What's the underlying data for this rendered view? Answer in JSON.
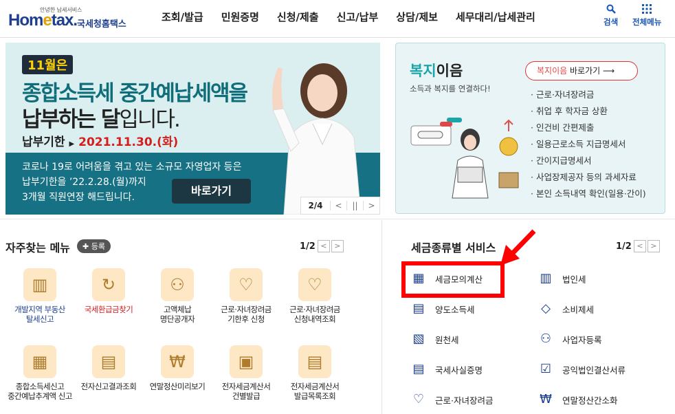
{
  "header": {
    "logo_small": "안녕한 납세서비스",
    "logo_brand_a": "Hom",
    "logo_brand_e": "e",
    "logo_brand_b": "tax.",
    "logo_kr": "국세청홈택스",
    "nav": [
      "조회/발급",
      "민원증명",
      "신청/제출",
      "신고/납부",
      "상담/제보",
      "세무대리/납세관리"
    ],
    "search_label": "검색",
    "menu_label": "전체메뉴"
  },
  "banner": {
    "month": "11월은",
    "headline1": "종합소득세 중간예납세액을",
    "headline2_bold": "납부하는 달",
    "headline2_rest": "입니다.",
    "due_label": "납부기한",
    "due_date": "2021.11.30.(화)",
    "body_line1": "코로나 19로 어려움을 겪고 있는 소규모 자영업자 등은",
    "body_line2": "납부기한을 ’22.2.28.(월)까지",
    "body_line3": "3개월 직원연장 해드립니다.",
    "go_label": "바로가기",
    "pager_count": "2/4",
    "pager_prev": "<",
    "pager_pause": "||",
    "pager_next": ">"
  },
  "welfare": {
    "title_accent": "복지",
    "title_rest": "이음",
    "subtitle": "소득과 복지를 연결하다!",
    "go_accent": "복지이음",
    "go_rest": "바로가기 ⟶",
    "items": [
      "근로·자녀장려금",
      "취업 후 학자금 상환",
      "인건비 간편제출",
      "일용근로소득 지급명세서",
      "간이지급명세서",
      "사업장제공자 등의 과세자료",
      "본인 소득내역 확인(일용·간이)"
    ]
  },
  "favorites": {
    "title": "자주찾는 메뉴",
    "register": "✚ 등록",
    "page": "1/2",
    "items": [
      {
        "l1": "개발지역 부동산",
        "l2": "탈세신고",
        "icon": "building-icon",
        "color": "#1e3f8f"
      },
      {
        "l1": "국세환급금찾기",
        "l2": "",
        "icon": "refund-icon",
        "color": "#d41d1d"
      },
      {
        "l1": "고액체납",
        "l2": "명단공개자",
        "icon": "people-icon",
        "color": "#222"
      },
      {
        "l1": "근로·자녀장려금",
        "l2": "기한후 신청",
        "icon": "heart-icon",
        "color": "#222"
      },
      {
        "l1": "근로·자녀장려금",
        "l2": "신청내역조회",
        "icon": "heart-search-icon",
        "color": "#222"
      },
      {
        "l1": "종합소득세신고",
        "l2": "중간예납추계액 신고",
        "icon": "calendar-icon",
        "color": "#222"
      },
      {
        "l1": "전자신고결과조회",
        "l2": "",
        "icon": "document-search-icon",
        "color": "#222"
      },
      {
        "l1": "연말정산미리보기",
        "l2": "",
        "icon": "money-bag-icon",
        "color": "#222"
      },
      {
        "l1": "전자세금계산서",
        "l2": "건별발급",
        "icon": "calculator-icon",
        "color": "#222"
      },
      {
        "l1": "전자세금계산서",
        "l2": "발급목록조회",
        "icon": "list-search-icon",
        "color": "#222"
      }
    ]
  },
  "taxservice": {
    "title": "세금종류별 서비스",
    "page": "1/2",
    "left": [
      {
        "label": "세금모의계산",
        "icon": "calculator-icon"
      },
      {
        "label": "양도소득세",
        "icon": "transfer-doc-icon"
      },
      {
        "label": "원천세",
        "icon": "receipt-icon"
      },
      {
        "label": "국세사실증명",
        "icon": "certificate-icon"
      },
      {
        "label": "근로·자녀장려금",
        "icon": "heart-icon"
      }
    ],
    "right": [
      {
        "label": "법인세",
        "icon": "building-icon"
      },
      {
        "label": "소비제세",
        "icon": "diamond-icon"
      },
      {
        "label": "사업자등록",
        "icon": "person-icon"
      },
      {
        "label": "공익법인결산서류",
        "icon": "clipboard-check-icon"
      },
      {
        "label": "연말정산간소화",
        "icon": "money-icon"
      }
    ]
  }
}
